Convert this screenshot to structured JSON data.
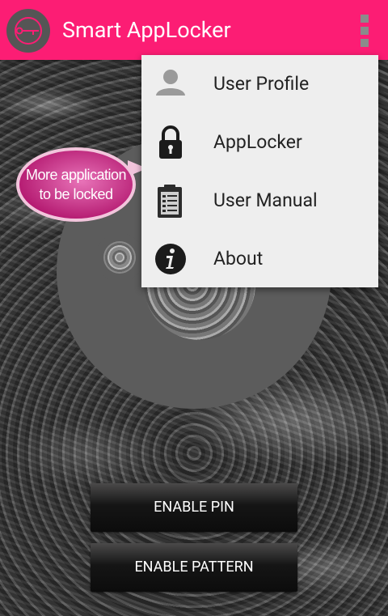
{
  "app": {
    "title": "Smart AppLocker",
    "icon": "power-lock-icon"
  },
  "bubble": {
    "line1": "More application",
    "line2": "to be locked"
  },
  "menu": {
    "items": [
      {
        "label": "User Profile",
        "icon": "user-icon"
      },
      {
        "label": "AppLocker",
        "icon": "padlock-icon"
      },
      {
        "label": "User Manual",
        "icon": "clipboard-icon"
      },
      {
        "label": "About",
        "icon": "info-icon"
      }
    ]
  },
  "buttons": {
    "enable_pin": "ENABLE PIN",
    "enable_pattern": "ENABLE PATTERN"
  },
  "colors": {
    "appbar": "#fc1d74",
    "menu_bg": "#eeeeee",
    "bubble": "#c8277f"
  }
}
